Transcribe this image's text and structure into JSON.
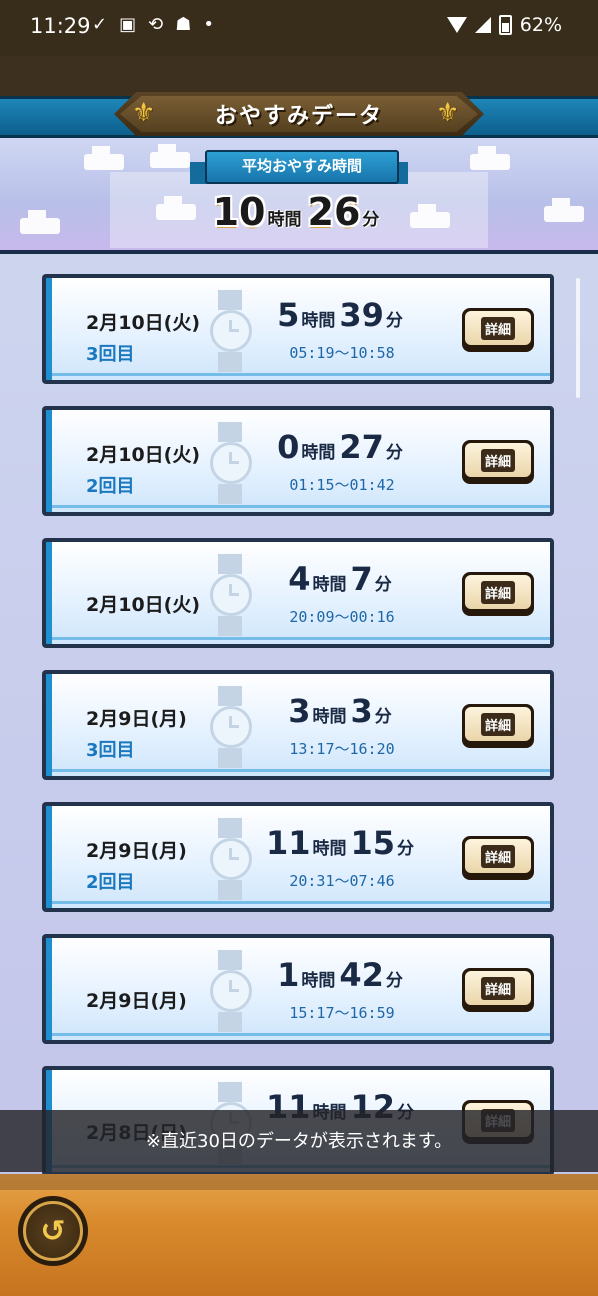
{
  "status_bar": {
    "time": "11:29",
    "battery": "62%"
  },
  "header": {
    "title": "おやすみデータ"
  },
  "summary": {
    "label": "平均おやすみ時間",
    "hours": "10",
    "hours_unit": "時間",
    "minutes": "26",
    "minutes_unit": "分"
  },
  "records": [
    {
      "date": "2月10日(火)",
      "count": "3回目",
      "hours": "5",
      "minutes": "39",
      "range": "05:19～10:58",
      "button": "詳細"
    },
    {
      "date": "2月10日(火)",
      "count": "2回目",
      "hours": "0",
      "minutes": "27",
      "range": "01:15～01:42",
      "button": "詳細"
    },
    {
      "date": "2月10日(火)",
      "count": "",
      "hours": "4",
      "minutes": "7",
      "range": "20:09～00:16",
      "button": "詳細"
    },
    {
      "date": "2月9日(月)",
      "count": "3回目",
      "hours": "3",
      "minutes": "3",
      "range": "13:17～16:20",
      "button": "詳細"
    },
    {
      "date": "2月9日(月)",
      "count": "2回目",
      "hours": "11",
      "minutes": "15",
      "range": "20:31～07:46",
      "button": "詳細"
    },
    {
      "date": "2月9日(月)",
      "count": "",
      "hours": "1",
      "minutes": "42",
      "range": "15:17～16:59",
      "button": "詳細"
    },
    {
      "date": "2月8日(日)",
      "count": "",
      "hours": "11",
      "minutes": "12",
      "range": "",
      "button": "詳細"
    }
  ],
  "units": {
    "hours": "時間",
    "minutes": "分"
  },
  "toast": "※直近30日のデータが表示されます。",
  "footer": {
    "back_icon": "back-arrow-icon"
  },
  "colors": {
    "accent_blue": "#1f8fd0",
    "header_blue": "#1d86b8",
    "footer_orange": "#d98a2c"
  }
}
